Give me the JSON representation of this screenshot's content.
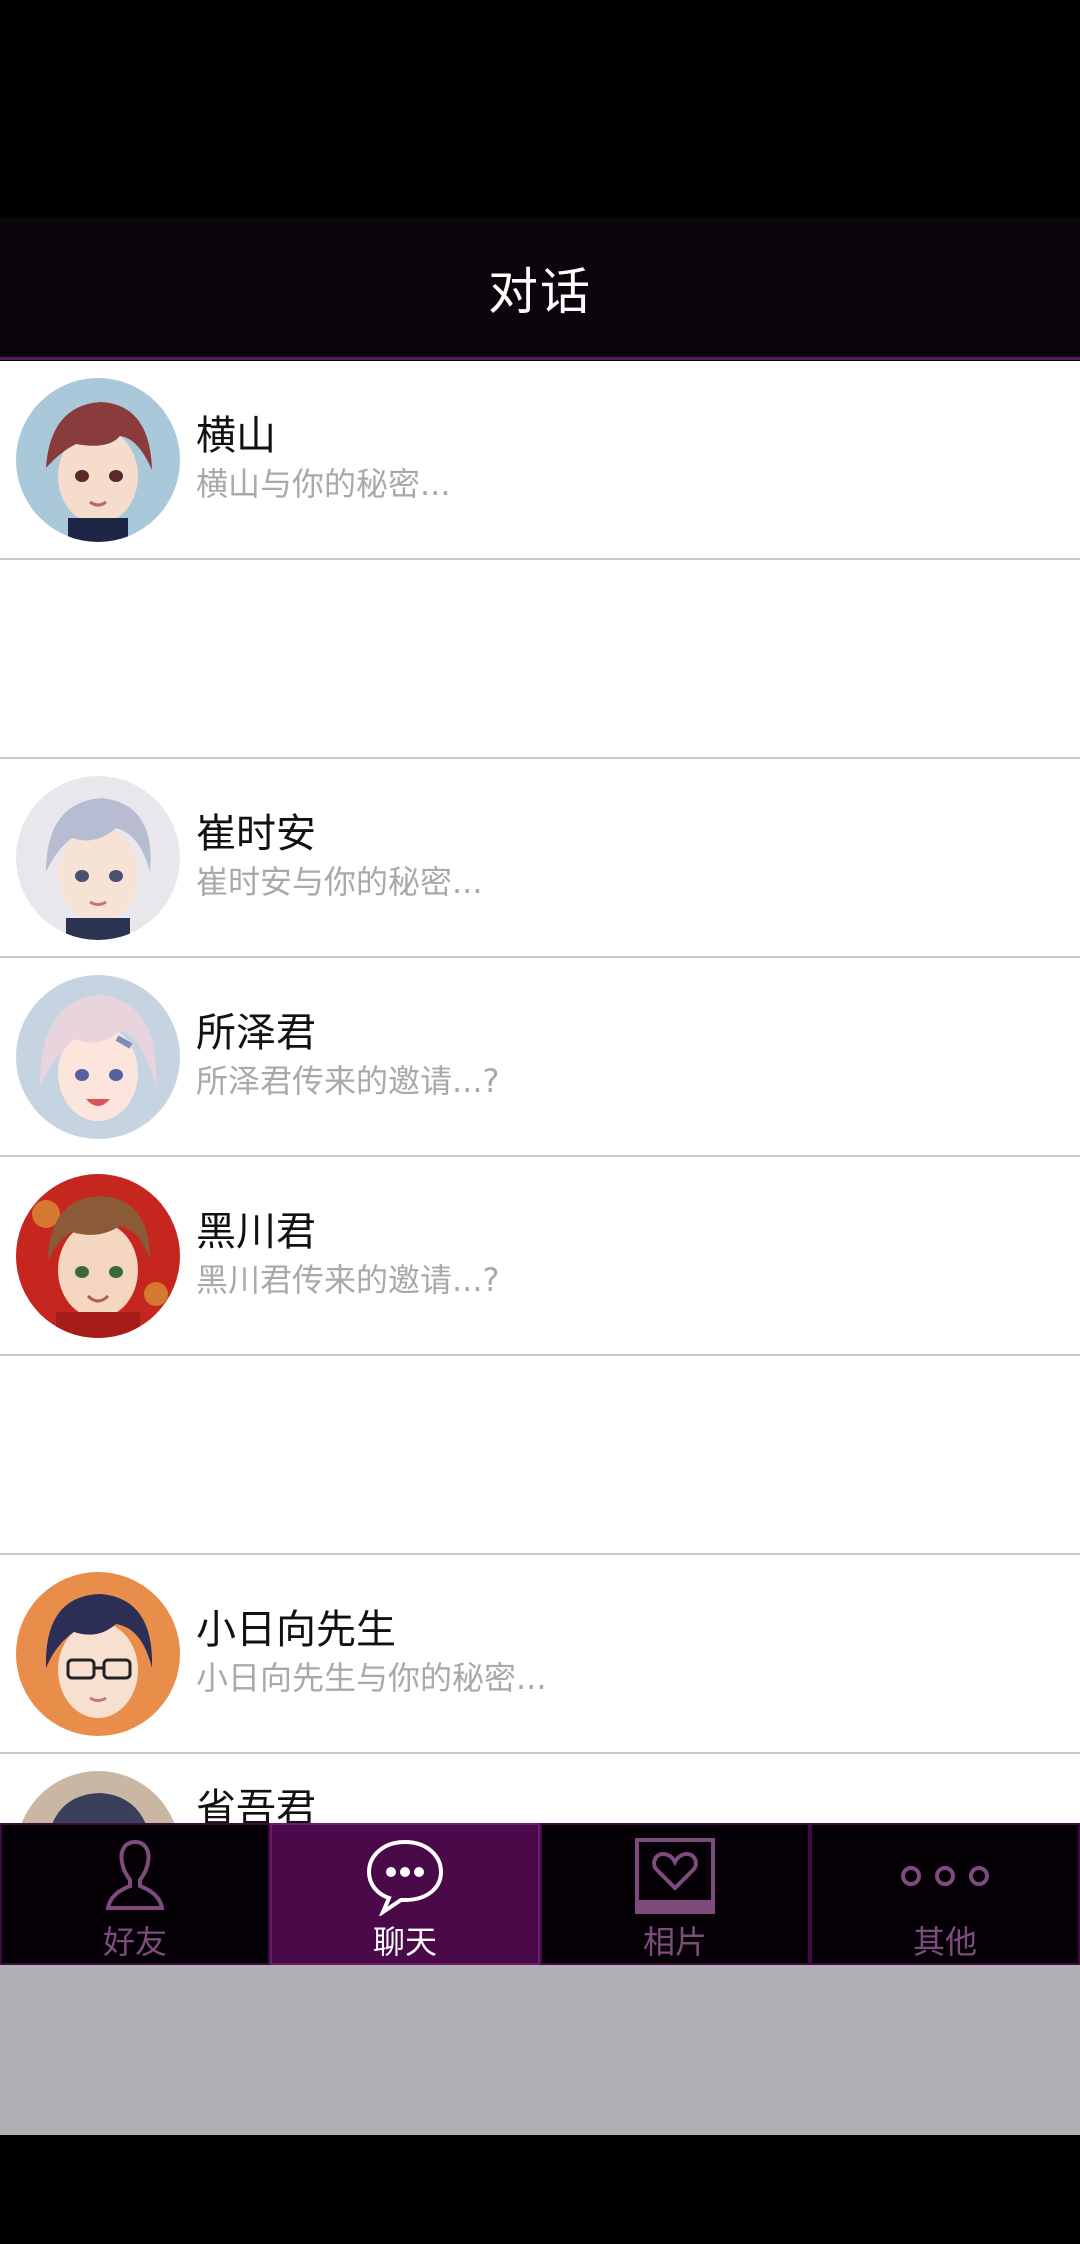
{
  "header": {
    "title": "对话"
  },
  "conversations": [
    {
      "name": "横山",
      "preview": "横山与你的秘密...",
      "avatar": "avatar-auburn-hair",
      "hair": "#8a3b3b",
      "bg": "#a9c8d9"
    },
    {
      "name": "",
      "preview": "",
      "avatar": "",
      "hair": "",
      "bg": ""
    },
    {
      "name": "崔时安",
      "preview": "崔时安与你的秘密...",
      "avatar": "avatar-silver-hair",
      "hair": "#b8bcd3",
      "bg": "#e8e8ec"
    },
    {
      "name": "所泽君",
      "preview": "所泽君传来的邀请...?",
      "avatar": "avatar-pink-hair",
      "hair": "#e7d4dc",
      "bg": "#c6d4e2"
    },
    {
      "name": "黑川君",
      "preview": "黑川君传来的邀请...?",
      "avatar": "avatar-brown-hair",
      "hair": "#8b5a36",
      "bg": "#c5261d"
    },
    {
      "name": "",
      "preview": "",
      "avatar": "",
      "hair": "",
      "bg": ""
    },
    {
      "name": "小日向先生",
      "preview": "小日向先生与你的秘密...",
      "avatar": "avatar-navy-hair-glasses",
      "hair": "#2b2f55",
      "bg": "#e98d4a"
    },
    {
      "name": "省吾君",
      "preview": "",
      "avatar": "avatar-dark-hair",
      "hair": "#3a3f5a",
      "bg": "#c9b6a3"
    }
  ],
  "tabs": [
    {
      "label": "好友",
      "icon": "person-icon",
      "active": false
    },
    {
      "label": "聊天",
      "icon": "chat-bubble-icon",
      "active": true
    },
    {
      "label": "相片",
      "icon": "photo-heart-icon",
      "active": false
    },
    {
      "label": "其他",
      "icon": "more-dots-icon",
      "active": false
    }
  ],
  "colors": {
    "accent": "#4a0a4a",
    "header_bg": "#0c060c",
    "tab_inactive_text": "#7d4c7d"
  }
}
